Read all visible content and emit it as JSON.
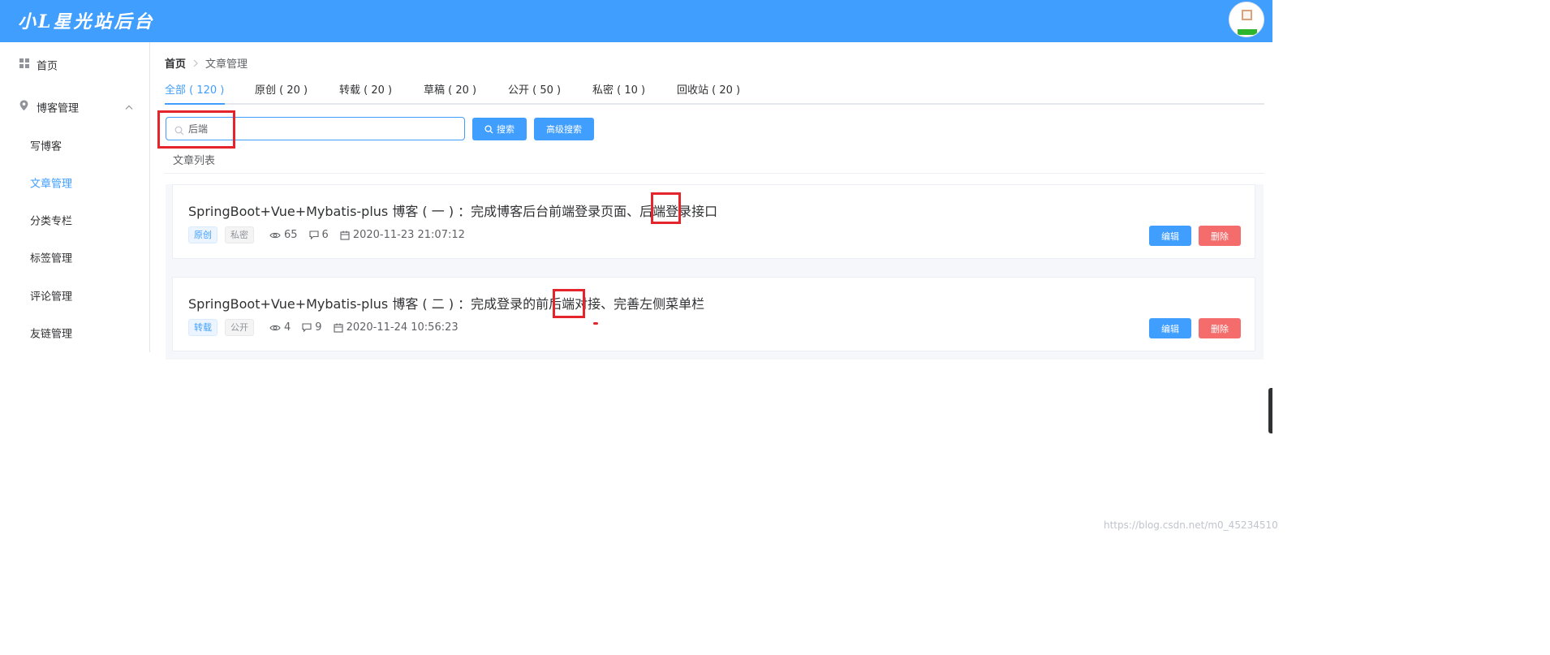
{
  "header": {
    "logo_text": "小L星光站后台"
  },
  "sidebar": {
    "home_label": "首页",
    "blog_manage_label": "博客管理",
    "sub_items": [
      {
        "label": "写博客",
        "active": false
      },
      {
        "label": "文章管理",
        "active": true
      },
      {
        "label": "分类专栏",
        "active": false
      },
      {
        "label": "标签管理",
        "active": false
      },
      {
        "label": "评论管理",
        "active": false
      },
      {
        "label": "友链管理",
        "active": false
      }
    ]
  },
  "breadcrumb": {
    "home": "首页",
    "current": "文章管理"
  },
  "tabs": [
    {
      "label": "全部 ( 120 )",
      "active": true
    },
    {
      "label": "原创 ( 20 )",
      "active": false
    },
    {
      "label": "转载 ( 20 )",
      "active": false
    },
    {
      "label": "草稿 ( 20 )",
      "active": false
    },
    {
      "label": "公开 ( 50 )",
      "active": false
    },
    {
      "label": "私密 ( 10 )",
      "active": false
    },
    {
      "label": "回收站 ( 20 )",
      "active": false
    }
  ],
  "search": {
    "value": "后端",
    "search_button": "搜索",
    "advanced_button": "高级搜索"
  },
  "list_title": "文章列表",
  "articles": [
    {
      "title": "SpringBoot+Vue+Mybatis-plus 博客 ( 一 ) ：完成博客后台前端登录页面、后端登录接口",
      "type_tag": "原创",
      "visibility_tag": "私密",
      "views": "65",
      "comments": "6",
      "date": "2020-11-23 21:07:12",
      "edit_label": "编辑",
      "delete_label": "删除"
    },
    {
      "title": "SpringBoot+Vue+Mybatis-plus 博客 ( 二 ) ：完成登录的前后端对接、完善左侧菜单栏",
      "type_tag": "转载",
      "visibility_tag": "公开",
      "views": "4",
      "comments": "9",
      "date": "2020-11-24 10:56:23",
      "edit_label": "编辑",
      "delete_label": "删除"
    }
  ],
  "watermark": "https://blog.csdn.net/m0_45234510",
  "colors": {
    "primary": "#409eff",
    "danger": "#f56c6c",
    "highlight_box": "#e5252c"
  }
}
